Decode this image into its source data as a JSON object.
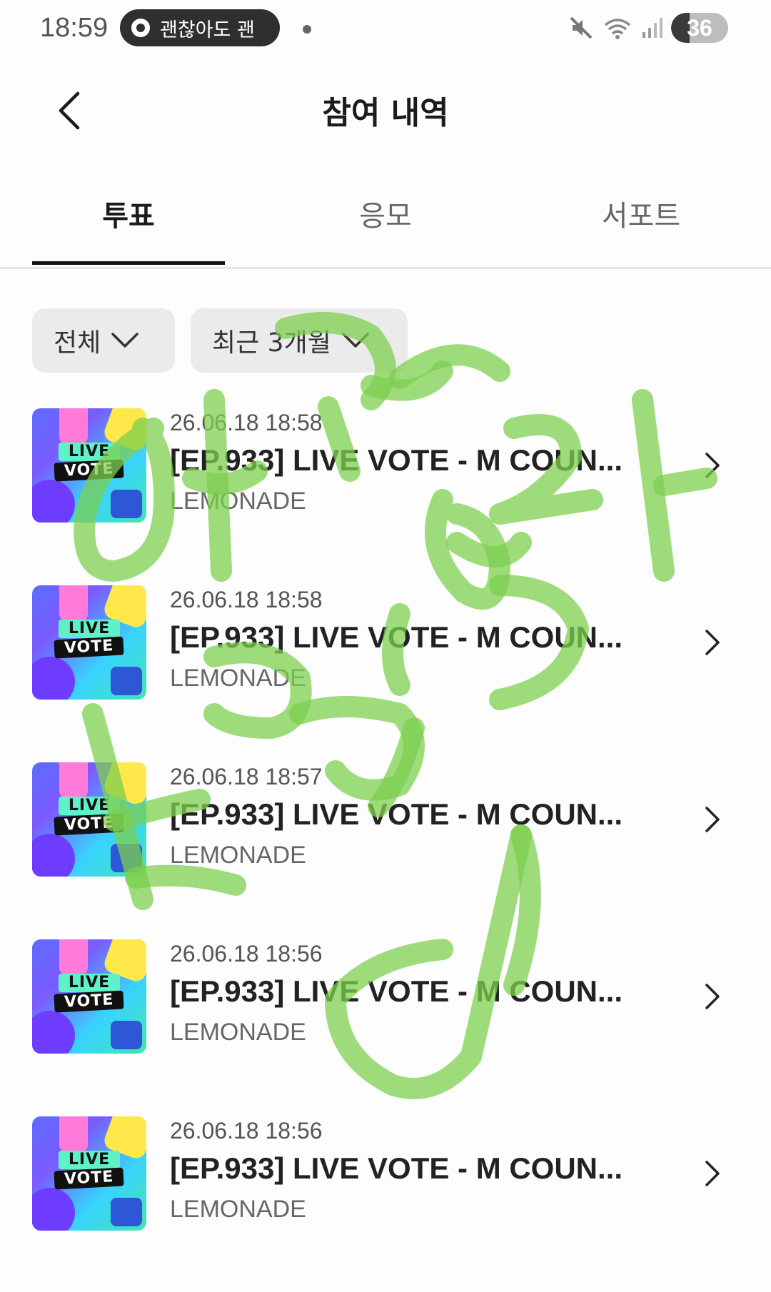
{
  "status_bar": {
    "time": "18:59",
    "notification_text": "괜찮아도 괜",
    "battery": "36",
    "icons": [
      "mute-icon",
      "wifi-icon",
      "signal-icon",
      "battery-icon"
    ]
  },
  "header": {
    "title": "참여 내역",
    "back_icon": "chevron-left-icon"
  },
  "tabs": [
    {
      "label": "투표",
      "active": true
    },
    {
      "label": "응모",
      "active": false
    },
    {
      "label": "서포트",
      "active": false
    }
  ],
  "filters": {
    "category": "전체",
    "period": "최근 3개월"
  },
  "items": [
    {
      "date": "26.06.18 18:58",
      "title": "[EP.933] LIVE VOTE - M COUN...",
      "org": "LEMONADE",
      "thumb_text": [
        "LIVE",
        "VOTE"
      ]
    },
    {
      "date": "26.06.18 18:58",
      "title": "[EP.933] LIVE VOTE - M COUN...",
      "org": "LEMONADE",
      "thumb_text": [
        "LIVE",
        "VOTE"
      ]
    },
    {
      "date": "26.06.18 18:57",
      "title": "[EP.933] LIVE VOTE - M COUN...",
      "org": "LEMONADE",
      "thumb_text": [
        "LIVE",
        "VOTE"
      ]
    },
    {
      "date": "26.06.18 18:56",
      "title": "[EP.933] LIVE VOTE - M COUN...",
      "org": "LEMONADE",
      "thumb_text": [
        "LIVE",
        "VOTE"
      ]
    },
    {
      "date": "26.06.18 18:56",
      "title": "[EP.933] LIVE VOTE - M COUN...",
      "org": "LEMONADE",
      "thumb_text": [
        "LIVE",
        "VOTE"
      ]
    }
  ],
  "colors": {
    "accent_underline": "#111111",
    "chip_bg": "#ebebeb",
    "scribble": "#7ccf4f"
  }
}
